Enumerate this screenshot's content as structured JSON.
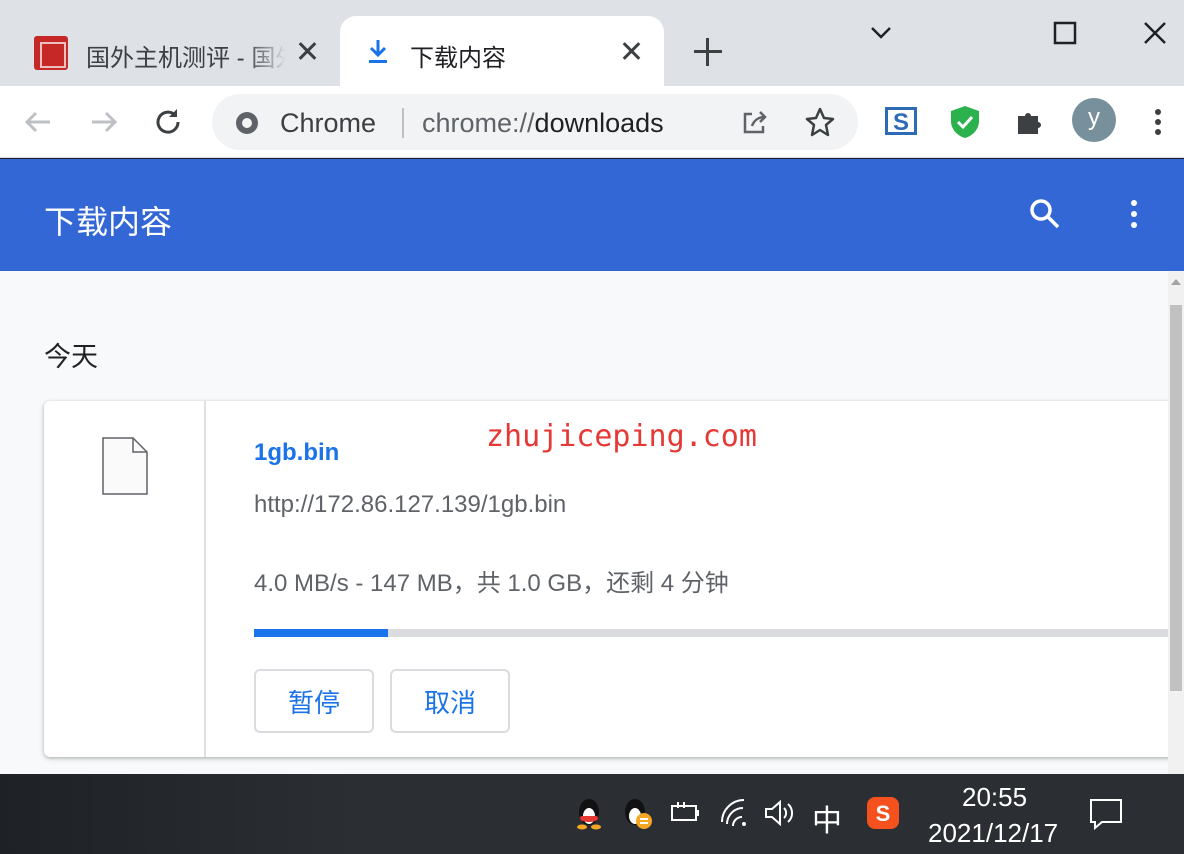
{
  "tabs": [
    {
      "title": "国外主机测评 - 国外",
      "active": false
    },
    {
      "title": "下载内容",
      "active": true
    }
  ],
  "omnibox": {
    "site": "Chrome",
    "url_scheme": "chrome://",
    "url_host": "downloads"
  },
  "profile": {
    "initial": "y"
  },
  "page": {
    "title": "下载内容"
  },
  "section": {
    "label": "今天"
  },
  "download": {
    "file_name": "1gb.bin",
    "url": "http://172.86.127.139/1gb.bin",
    "status": "4.0 MB/s - 147 MB，共 1.0 GB，还剩 4 分钟",
    "progress_fraction": 0.147,
    "pause_label": "暂停",
    "cancel_label": "取消"
  },
  "watermark": "zhujiceping.com",
  "taskbar": {
    "ime": "中",
    "time": "20:55",
    "date": "2021/12/17"
  },
  "colors": {
    "header": "#3367d6",
    "accent": "#1a73e8",
    "watermark": "#e53935"
  }
}
